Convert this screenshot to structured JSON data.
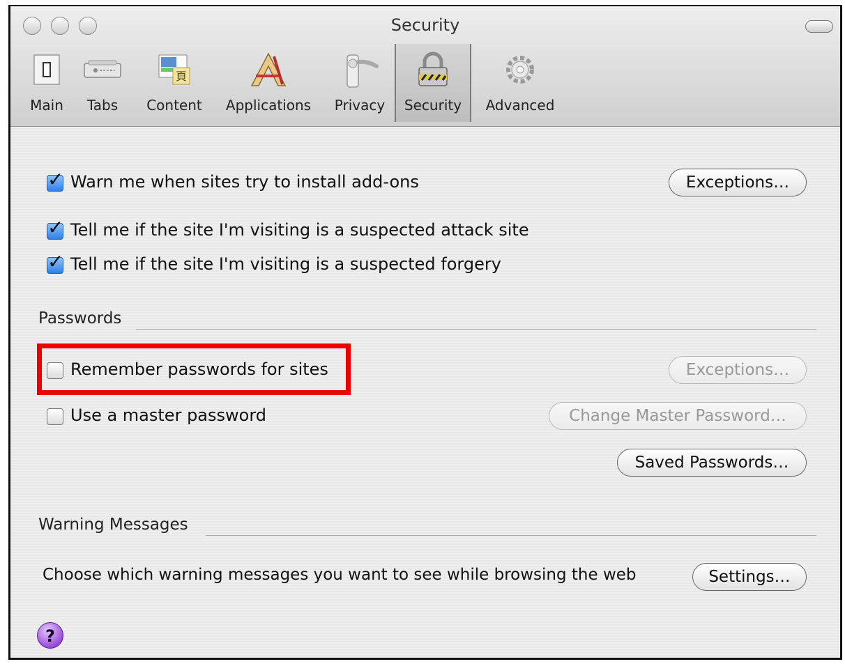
{
  "window": {
    "title": "Security"
  },
  "toolbar": {
    "items": [
      {
        "label": "Main",
        "icon": "switch-icon"
      },
      {
        "label": "Tabs",
        "icon": "tabs-icon"
      },
      {
        "label": "Content",
        "icon": "content-icon"
      },
      {
        "label": "Applications",
        "icon": "applications-icon"
      },
      {
        "label": "Privacy",
        "icon": "door-handle-icon"
      },
      {
        "label": "Security",
        "icon": "padlock-icon",
        "selected": true
      },
      {
        "label": "Advanced",
        "icon": "gear-icon"
      }
    ]
  },
  "general": {
    "warn_addons": {
      "label": "Warn me when sites try to install add-ons",
      "checked": true,
      "button": "Exceptions…"
    },
    "attack_site": {
      "label": "Tell me if the site I'm visiting is a suspected attack site",
      "checked": true
    },
    "forgery": {
      "label": "Tell me if the site I'm visiting is a suspected forgery",
      "checked": true
    }
  },
  "passwords": {
    "heading": "Passwords",
    "remember": {
      "label": "Remember passwords for sites",
      "checked": false,
      "button": "Exceptions…",
      "button_enabled": false
    },
    "master": {
      "label": "Use a master password",
      "checked": false,
      "button": "Change Master Password…",
      "button_enabled": false
    },
    "saved_button": "Saved Passwords…"
  },
  "warnings": {
    "heading": "Warning Messages",
    "text": "Choose which warning messages you want to see while browsing the web",
    "button": "Settings…"
  },
  "help": {
    "glyph": "?"
  },
  "colors": {
    "highlight": "#ec0000",
    "checkbox": "#2e7fe8",
    "help": "#9a4ed8"
  }
}
